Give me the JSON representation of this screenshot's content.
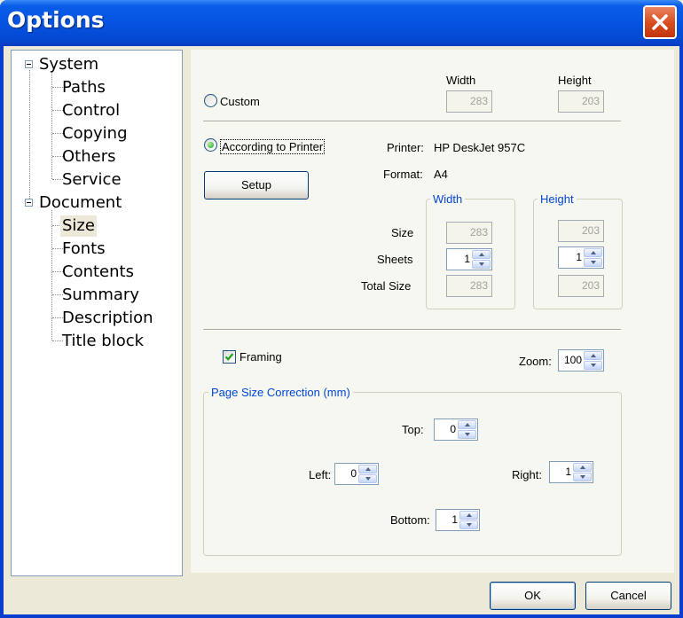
{
  "window": {
    "title": "Options"
  },
  "tree": {
    "items": [
      {
        "label": "System"
      },
      {
        "label": "Paths"
      },
      {
        "label": "Control"
      },
      {
        "label": "Copying"
      },
      {
        "label": "Others"
      },
      {
        "label": "Service"
      },
      {
        "label": "Document"
      },
      {
        "label": "Size"
      },
      {
        "label": "Fonts"
      },
      {
        "label": "Contents"
      },
      {
        "label": "Summary"
      },
      {
        "label": "Description"
      },
      {
        "label": "Title block"
      }
    ]
  },
  "custom": {
    "radio_label": "Custom",
    "width_label": "Width",
    "height_label": "Height",
    "width_value": "283",
    "height_value": "203"
  },
  "printer_mode": {
    "radio_label": "According to Printer",
    "printer_label": "Printer:",
    "printer_value": "HP DeskJet 957C",
    "format_label": "Format:",
    "format_value": "A4",
    "setup_button": "Setup",
    "width_group": "Width",
    "height_group": "Height",
    "size_label": "Size",
    "sheets_label": "Sheets",
    "total_size_label": "Total Size",
    "size_width": "283",
    "size_height": "203",
    "sheets_width": "1",
    "sheets_height": "1",
    "total_width": "283",
    "total_height": "203"
  },
  "framing": {
    "label": "Framing",
    "checked": true
  },
  "zoom": {
    "label": "Zoom:",
    "value": "100"
  },
  "correction": {
    "title": "Page Size Correction (mm)",
    "top_label": "Top:",
    "top_value": "0",
    "left_label": "Left:",
    "left_value": "0",
    "right_label": "Right:",
    "right_value": "1",
    "bottom_label": "Bottom:",
    "bottom_value": "1"
  },
  "buttons": {
    "ok": "OK",
    "cancel": "Cancel"
  },
  "colors": {
    "title_bar": "#0553e0",
    "close": "#d8491e",
    "accent_text": "#0046d5"
  }
}
